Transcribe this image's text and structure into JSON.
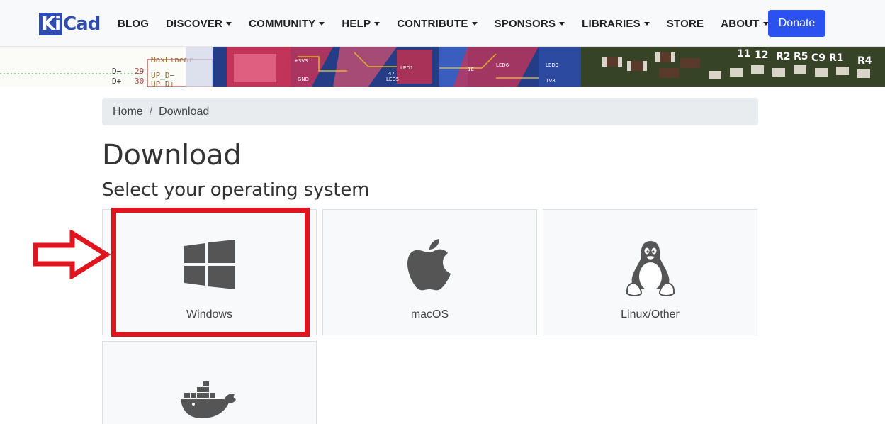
{
  "logo": {
    "part1": "Ki",
    "part2": "Cad"
  },
  "nav": {
    "items": [
      {
        "label": "BLOG",
        "dropdown": false
      },
      {
        "label": "DISCOVER",
        "dropdown": true
      },
      {
        "label": "COMMUNITY",
        "dropdown": true
      },
      {
        "label": "HELP",
        "dropdown": true
      },
      {
        "label": "CONTRIBUTE",
        "dropdown": true
      },
      {
        "label": "SPONSORS",
        "dropdown": true
      },
      {
        "label": "LIBRARIES",
        "dropdown": true
      },
      {
        "label": "STORE",
        "dropdown": false
      },
      {
        "label": "ABOUT",
        "dropdown": true
      }
    ],
    "donate_label": "Donate"
  },
  "banner": {
    "schematic_chip": "MaxLinear",
    "pins": [
      "D−",
      "D+",
      "29",
      "30",
      "UP_D−",
      "UP_D+"
    ],
    "pcb_labels": [
      "+3V3",
      "GND",
      "LED1",
      "LED5",
      "LED6",
      "1E",
      "1V8",
      "LED3",
      "47",
      "R5",
      "C9",
      "R1",
      "R2",
      "R4",
      "11",
      "12"
    ]
  },
  "breadcrumb": {
    "home": "Home",
    "separator": "/",
    "current": "Download"
  },
  "page": {
    "title": "Download",
    "subtitle": "Select your operating system"
  },
  "os_cards": {
    "windows": {
      "label": "Windows",
      "icon": "windows-icon"
    },
    "macos": {
      "label": "macOS",
      "icon": "apple-icon"
    },
    "linux": {
      "label": "Linux/Other",
      "icon": "tux-penguin-icon"
    },
    "docker": {
      "label": "",
      "icon": "docker-whale-icon"
    }
  },
  "annotation": {
    "color": "#e0141e",
    "arrow_icon": "right-arrow-icon"
  },
  "colors": {
    "brand": "#314cb0",
    "donate": "#2b52f0",
    "highlight": "#e0141e",
    "icon": "#555555"
  }
}
